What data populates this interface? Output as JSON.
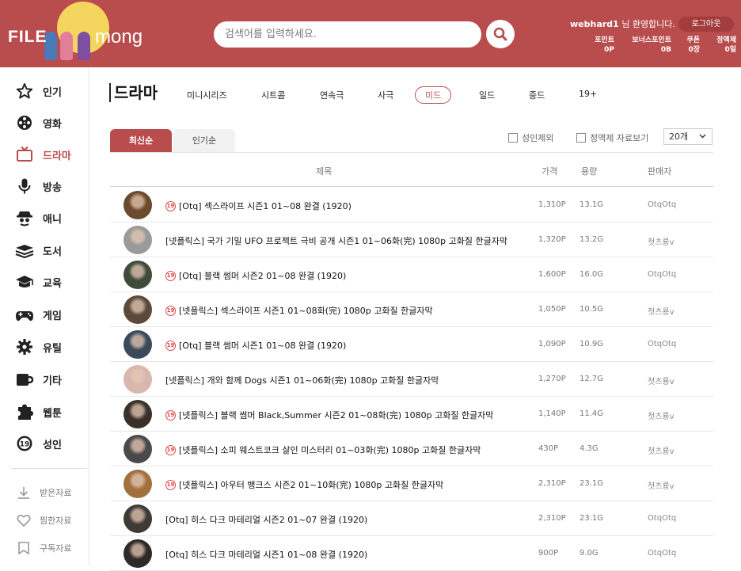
{
  "header": {
    "logo_left": "FILE",
    "logo_right": "mong",
    "search_placeholder": "검색어를 입력하세요.",
    "username": "webhard1",
    "welcome_suffix": "님 환영합니다.",
    "logout_label": "로그아웃",
    "stats": [
      {
        "label": "포인트",
        "value": "0P"
      },
      {
        "label": "보너스포인트",
        "value": "0B"
      },
      {
        "label": "쿠폰",
        "value": "0장"
      },
      {
        "label": "정액제",
        "value": "0일"
      }
    ]
  },
  "sidebar": {
    "categories": [
      {
        "label": "인기",
        "icon": "star-icon"
      },
      {
        "label": "영화",
        "icon": "film-reel-icon"
      },
      {
        "label": "드라마",
        "icon": "tv-icon"
      },
      {
        "label": "방송",
        "icon": "microphone-icon"
      },
      {
        "label": "애니",
        "icon": "anime-character-icon"
      },
      {
        "label": "도서",
        "icon": "books-icon"
      },
      {
        "label": "교육",
        "icon": "graduation-cap-icon"
      },
      {
        "label": "게임",
        "icon": "gamepad-icon"
      },
      {
        "label": "유틸",
        "icon": "gear-icon"
      },
      {
        "label": "기타",
        "icon": "cup-icon"
      },
      {
        "label": "웹툰",
        "icon": "puzzle-icon"
      },
      {
        "label": "성인",
        "icon": "adult-19-icon"
      }
    ],
    "active_category": "드라마",
    "sub_items": [
      {
        "label": "받은자료",
        "icon": "download-icon"
      },
      {
        "label": "찜한자료",
        "icon": "heart-icon"
      },
      {
        "label": "구독자료",
        "icon": "bookmark-icon"
      }
    ]
  },
  "main": {
    "page_title": "드라마",
    "subtabs": [
      "미니시리즈",
      "시트콤",
      "연속극",
      "사극",
      "미드",
      "일드",
      "중드",
      "19+"
    ],
    "active_subtab": "미드",
    "sort_tabs": [
      "최신순",
      "인기순"
    ],
    "filters": [
      "성인제외",
      "정액제 자료보기"
    ],
    "page_size": "20개",
    "columns": {
      "title": "제목",
      "price": "가격",
      "size": "용량",
      "seller": "판매자"
    },
    "rows": [
      {
        "adult": true,
        "title": "[Otq] 섹스라이프 시즌1 01~08 완결 (1920)",
        "price": "1,310P",
        "size": "13.1G",
        "seller": "OtqOtq",
        "thumb_color": "#6b4a2e"
      },
      {
        "adult": false,
        "title": "[넷플릭스] 국가 기밀 UFO 프로젝트 극비 공개 시즌1 01~06화(完) 1080p 고화질 한글자막",
        "price": "1,320P",
        "size": "13.2G",
        "seller": "첫츠룡v",
        "thumb_color": "#9a9a9a"
      },
      {
        "adult": true,
        "title": "[Otq] 블랙 썸머 시즌2 01~08 완결 (1920)",
        "price": "1,600P",
        "size": "16.0G",
        "seller": "OtqOtq",
        "thumb_color": "#3f4a3a"
      },
      {
        "adult": true,
        "title": "[넷플릭스] 섹스라이프 시즌1 01~08화(完) 1080p 고화질 한글자막",
        "price": "1,050P",
        "size": "10.5G",
        "seller": "첫츠룡v",
        "thumb_color": "#5b4a3b"
      },
      {
        "adult": true,
        "title": "[Otq] 블랙 썸머 시즌1 01~08 완결 (1920)",
        "price": "1,090P",
        "size": "10.9G",
        "seller": "OtqOtq",
        "thumb_color": "#3a4a5a"
      },
      {
        "adult": false,
        "title": "[넷플릭스] 개와 함께 Dogs 시즌1 01~06화(完) 1080p 고화질 한글자막",
        "price": "1,270P",
        "size": "12.7G",
        "seller": "첫츠룡v",
        "thumb_color": "#d7b7ae"
      },
      {
        "adult": true,
        "title": "[넷플릭스] 블랙 썸머 Black,Summer 시즌2 01~08화(完) 1080p 고화질 한글자막",
        "price": "1,140P",
        "size": "11.4G",
        "seller": "첫츠룡v",
        "thumb_color": "#3a302a"
      },
      {
        "adult": true,
        "title": "[넷플릭스] 소피 웨스트코크 살인 미스터리 01~03화(完) 1080p 고화질 한글자막",
        "price": "430P",
        "size": "4.3G",
        "seller": "첫츠룡v",
        "thumb_color": "#4a4a4a"
      },
      {
        "adult": true,
        "title": "[넷플릭스] 아우터 뱅크스 시즌2 01~10화(完) 1080p 고화질 한글자막",
        "price": "2,310P",
        "size": "23.1G",
        "seller": "첫츠룡v",
        "thumb_color": "#a0703f"
      },
      {
        "adult": false,
        "title": "[Otq] 히스 다크 마테리얼 시즌2 01~07 완결 (1920)",
        "price": "2,310P",
        "size": "23.1G",
        "seller": "OtqOtq",
        "thumb_color": "#3e3a35"
      },
      {
        "adult": false,
        "title": "[Otq] 히스 다크 마테리얼 시즌1 01~08 완결 (1920)",
        "price": "900P",
        "size": "9.0G",
        "seller": "OtqOtq",
        "thumb_color": "#2e2a28"
      }
    ]
  },
  "colors": {
    "brand": "#b94d4d",
    "adult_badge": "#e04646"
  }
}
